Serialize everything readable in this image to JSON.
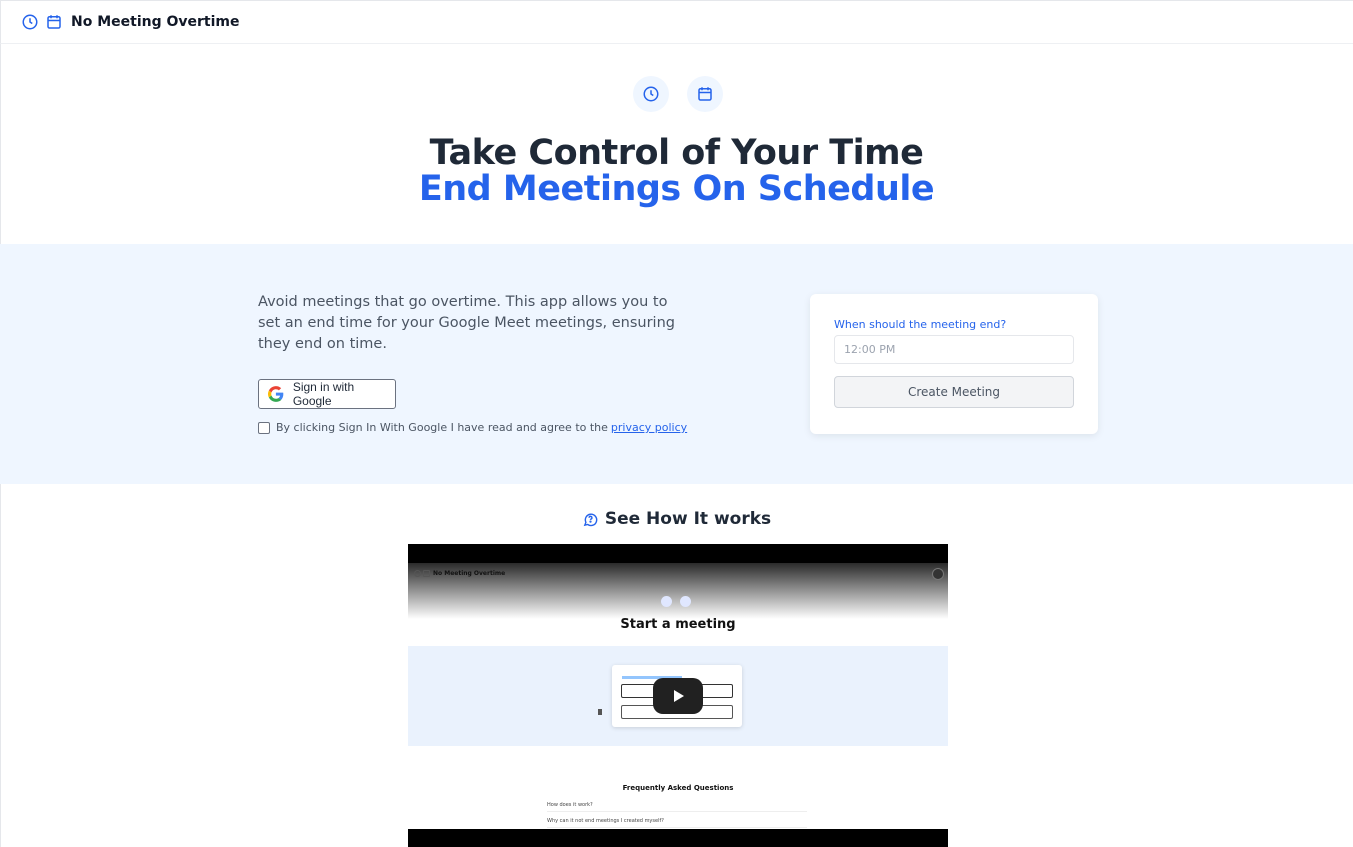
{
  "header": {
    "brand": "No Meeting Overtime",
    "icons": [
      "clock-icon",
      "calendar-icon"
    ]
  },
  "hero": {
    "title_line1": "Take Control of Your Time",
    "title_line2": "End Meetings On Schedule"
  },
  "intro": {
    "text": "Avoid meetings that go overtime. This app allows you to set an end time for your Google Meet meetings, ensuring they end on time."
  },
  "signin": {
    "button_label": "Sign in with Google",
    "consent_text": "By clicking Sign In With Google I have read and agree to the",
    "consent_link": "privacy policy"
  },
  "form": {
    "label": "When should the meeting end?",
    "placeholder": "12:00 PM",
    "button_label": "Create Meeting"
  },
  "video_section": {
    "heading": "See How It works",
    "video": {
      "brand": "No Meeting Overtime",
      "heading": "Start a meeting",
      "faq_title": "Frequently Asked Questions",
      "faq_items": [
        "How does it work?",
        "Why can it not end meetings I created myself?"
      ]
    }
  },
  "colors": {
    "accent": "#2563eb",
    "band_bg": "#eff6ff",
    "text_dark": "#1f2937"
  }
}
